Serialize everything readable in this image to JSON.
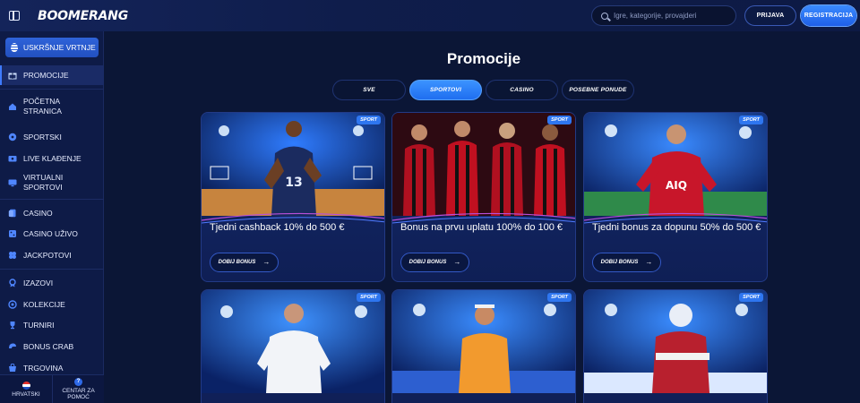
{
  "header": {
    "brand": "BOOMERANG",
    "search_placeholder": "Igre, kategorije, provajderi",
    "login_label": "PRIJAVA",
    "register_label": "REGISTRACIJA"
  },
  "sidebar": {
    "feature": {
      "label": "USKRŠNJE VRTNJE",
      "icon": "easter-egg-icon"
    },
    "items": [
      {
        "label": "PROMOCIJE",
        "icon": "gift-icon",
        "active": true
      },
      {
        "label": "POČETNA STRANICA",
        "icon": "home-icon"
      },
      {
        "label": "SPORTSKI",
        "icon": "soccer-ball-icon"
      },
      {
        "label": "LIVE KLAĐENJE",
        "icon": "live-tv-icon"
      },
      {
        "label": "VIRTUALNI SPORTOVI",
        "icon": "monitor-icon"
      },
      {
        "label": "CASINO",
        "icon": "cards-icon"
      },
      {
        "label": "CASINO UŽIVO",
        "icon": "dice-icon"
      },
      {
        "label": "JACKPOTOVI",
        "icon": "clover-icon"
      },
      {
        "label": "IZAZOVI",
        "icon": "medal-icon"
      },
      {
        "label": "KOLEKCIJE",
        "icon": "collection-icon"
      },
      {
        "label": "TURNIRI",
        "icon": "trophy-icon"
      },
      {
        "label": "BONUS CRAB",
        "icon": "crab-icon"
      },
      {
        "label": "TRGOVINA",
        "icon": "shop-icon"
      }
    ],
    "bottom": {
      "language": "HRVATSKI",
      "help": "CENTAR ZA POMOĆ"
    }
  },
  "main": {
    "title": "Promocije",
    "tabs": [
      {
        "label": "SVE",
        "active": false
      },
      {
        "label": "SPORTOVI",
        "active": true
      },
      {
        "label": "CASINO",
        "active": false
      },
      {
        "label": "POSEBNE PONUDE",
        "active": false
      }
    ],
    "cards": [
      {
        "badge": "SPORT",
        "title": "Tjedni cashback 10% do 500 €",
        "button": "DOBIJ BONUS",
        "image": "basketball-player"
      },
      {
        "badge": "SPORT",
        "title": "Bonus na prvu uplatu 100% do 100 €",
        "button": "DOBIJ BONUS",
        "image": "football-team-red-black"
      },
      {
        "badge": "SPORT",
        "title": "Tjedni bonus za dopunu 50% do 500 €",
        "button": "DOBIJ BONUS",
        "image": "football-player-red"
      },
      {
        "badge": "SPORT",
        "title": "",
        "button": "",
        "image": "football-player-white"
      },
      {
        "badge": "SPORT",
        "title": "",
        "button": "",
        "image": "tennis-player"
      },
      {
        "badge": "SPORT",
        "title": "",
        "button": "",
        "image": "hockey-player"
      }
    ]
  },
  "colors": {
    "background": "#0b1636",
    "sidebar": "#0e1b47",
    "accent": "#2f6ae8",
    "active_tab": "#1f6ef0"
  }
}
